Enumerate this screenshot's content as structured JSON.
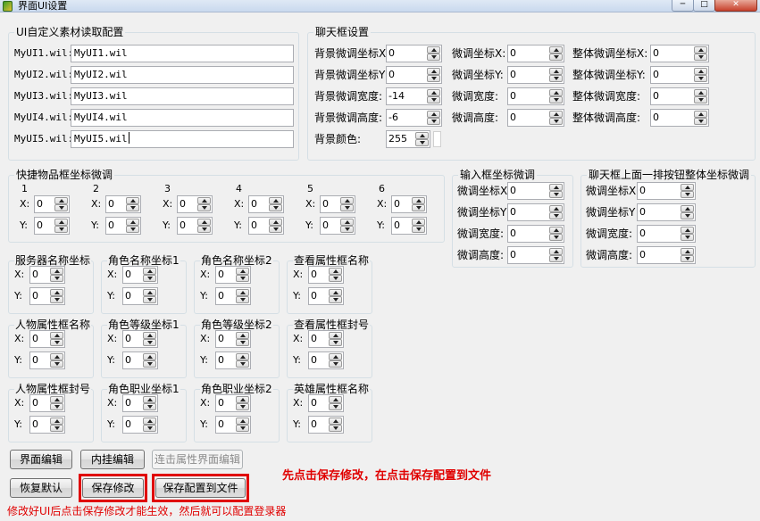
{
  "window": {
    "title": "界面UI设置",
    "min_label": "─",
    "max_label": "□",
    "close_label": "✕"
  },
  "ui_config": {
    "legend": "UI自定义素材读取配置",
    "rows": [
      {
        "label": "MyUI1.wil:",
        "value": "MyUI1.wil"
      },
      {
        "label": "MyUI2.wil:",
        "value": "MyUI2.wil"
      },
      {
        "label": "MyUI3.wil:",
        "value": "MyUI3.wil"
      },
      {
        "label": "MyUI4.wil:",
        "value": "MyUI4.wil"
      },
      {
        "label": "MyUI5.wil:",
        "value": "MyUI5.wil"
      }
    ]
  },
  "chat_box": {
    "legend": "聊天框设置",
    "col1": [
      {
        "label": "背景微调坐标X",
        "value": "0"
      },
      {
        "label": "背景微调坐标Y",
        "value": "0"
      },
      {
        "label": "背景微调宽度:",
        "value": "-14"
      },
      {
        "label": "背景微调高度:",
        "value": "-6"
      }
    ],
    "col2": [
      {
        "label": "微调坐标X:",
        "value": "0"
      },
      {
        "label": "微调坐标Y:",
        "value": "0"
      },
      {
        "label": "微调宽度:",
        "value": "0"
      },
      {
        "label": "微调高度:",
        "value": "0"
      }
    ],
    "col3": [
      {
        "label": "整体微调坐标X:",
        "value": "0"
      },
      {
        "label": "整体微调坐标Y:",
        "value": "0"
      },
      {
        "label": "整体微调宽度:",
        "value": "0"
      },
      {
        "label": "整体微调高度:",
        "value": "0"
      }
    ],
    "bg_color_label": "背景颜色:",
    "bg_color_value": "255"
  },
  "quick_items": {
    "legend": "快捷物品框坐标微调",
    "slots": [
      {
        "name": "1",
        "x_label": "X:",
        "x": "0",
        "y_label": "Y:",
        "y": "0"
      },
      {
        "name": "2",
        "x_label": "X:",
        "x": "0",
        "y_label": "Y:",
        "y": "0"
      },
      {
        "name": "3",
        "x_label": "X:",
        "x": "0",
        "y_label": "Y:",
        "y": "0"
      },
      {
        "name": "4",
        "x_label": "X:",
        "x": "0",
        "y_label": "Y:",
        "y": "0"
      },
      {
        "name": "5",
        "x_label": "X:",
        "x": "0",
        "y_label": "Y:",
        "y": "0"
      },
      {
        "name": "6",
        "x_label": "X:",
        "x": "0",
        "y_label": "Y:",
        "y": "0"
      }
    ]
  },
  "input_box": {
    "legend": "输入框坐标微调",
    "rows": [
      {
        "label": "微调坐标X",
        "value": "0"
      },
      {
        "label": "微调坐标Y",
        "value": "0"
      },
      {
        "label": "微调宽度:",
        "value": "0"
      },
      {
        "label": "微调高度:",
        "value": "0"
      }
    ]
  },
  "chat_buttons": {
    "legend": "聊天框上面一排按钮整体坐标微调",
    "rows": [
      {
        "label": "微调坐标X",
        "value": "0"
      },
      {
        "label": "微调坐标Y",
        "value": "0"
      },
      {
        "label": "微调宽度:",
        "value": "0"
      },
      {
        "label": "微调高度:",
        "value": "0"
      }
    ]
  },
  "coord_groups": [
    {
      "legend": "服务器名称坐标",
      "x_label": "X:",
      "x": "0",
      "y_label": "Y:",
      "y": "0"
    },
    {
      "legend": "角色名称坐标1",
      "x_label": "X:",
      "x": "0",
      "y_label": "Y:",
      "y": "0"
    },
    {
      "legend": "角色名称坐标2",
      "x_label": "X:",
      "x": "0",
      "y_label": "Y:",
      "y": "0"
    },
    {
      "legend": "查看属性框名称",
      "x_label": "X:",
      "x": "0",
      "y_label": "Y:",
      "y": "0"
    },
    {
      "legend": "人物属性框名称",
      "x_label": "X:",
      "x": "0",
      "y_label": "Y:",
      "y": "0"
    },
    {
      "legend": "角色等级坐标1",
      "x_label": "X:",
      "x": "0",
      "y_label": "Y:",
      "y": "0"
    },
    {
      "legend": "角色等级坐标2",
      "x_label": "X:",
      "x": "0",
      "y_label": "Y:",
      "y": "0"
    },
    {
      "legend": "查看属性框封号",
      "x_label": "X:",
      "x": "0",
      "y_label": "Y:",
      "y": "0"
    },
    {
      "legend": "人物属性框封号",
      "x_label": "X:",
      "x": "0",
      "y_label": "Y:",
      "y": "0"
    },
    {
      "legend": "角色职业坐标1",
      "x_label": "X:",
      "x": "0",
      "y_label": "Y:",
      "y": "0"
    },
    {
      "legend": "角色职业坐标2",
      "x_label": "X:",
      "x": "0",
      "y_label": "Y:",
      "y": "0"
    },
    {
      "legend": "英雄属性框名称",
      "x_label": "X:",
      "x": "0",
      "y_label": "Y:",
      "y": "0"
    }
  ],
  "buttons": {
    "ui_edit": "界面编辑",
    "plugin_edit": "内挂编辑",
    "linked_edit": "连击属性界面编辑",
    "restore": "恢复默认",
    "save_changes": "保存修改",
    "save_to_file": "保存配置到文件"
  },
  "notes": {
    "hint": "先点击保存修改，在点击保存配置到文件",
    "footer": "修改好UI后点击保存修改才能生效，然后就可以配置登录器"
  },
  "colors": {
    "highlight": "#e00000",
    "note": "#e00000"
  }
}
